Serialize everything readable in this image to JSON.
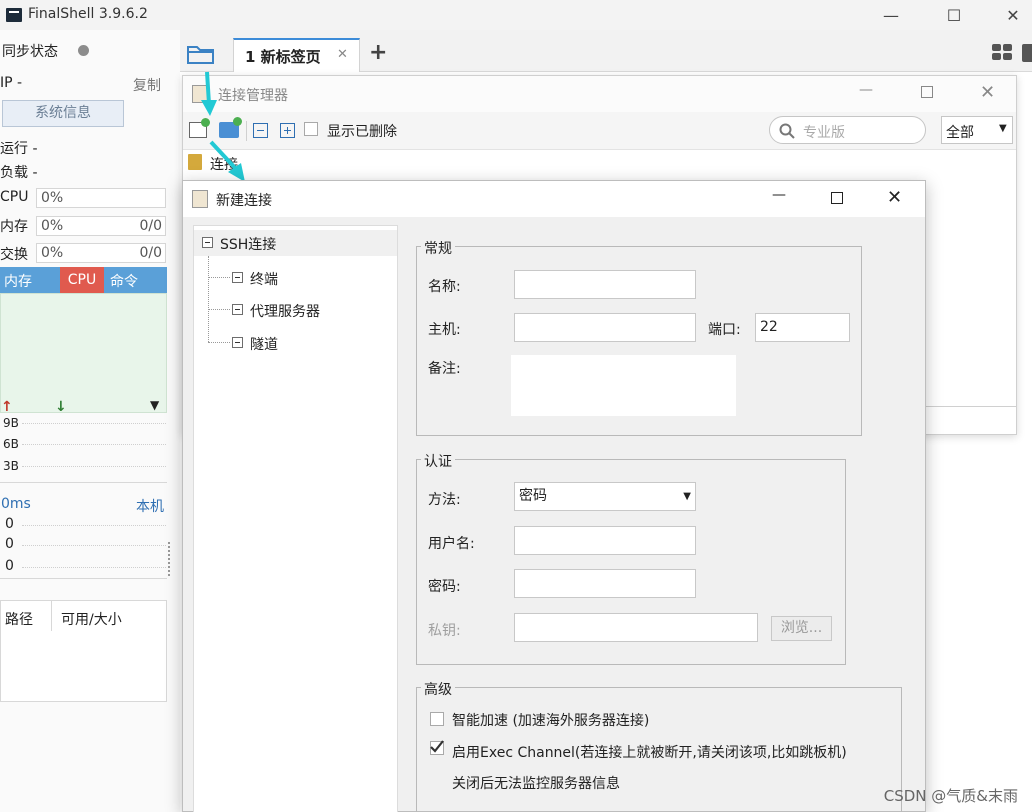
{
  "app": {
    "title": "FinalShell 3.9.6.2"
  },
  "window_controls": {
    "minimize": "—",
    "maximize": "☐",
    "close": "✕"
  },
  "left_panel": {
    "sync_label": "同步状态",
    "ip_label": "IP  -",
    "copy_label": "复制",
    "sysinfo_button": "系统信息",
    "run_label": "运行 -",
    "load_label": "负载 -",
    "cpu_label": "CPU",
    "cpu_value": "0%",
    "mem_label": "内存",
    "mem_value": "0%",
    "mem_ratio": "0/0",
    "swap_label": "交换",
    "swap_value": "0%",
    "swap_ratio": "0/0",
    "tabs": [
      "内存",
      "CPU",
      "命令"
    ],
    "net_rows": [
      "9B",
      "6B",
      "3B"
    ],
    "ping_label": "0ms",
    "local_label": "本机",
    "ping_rows": [
      "0",
      "0",
      "0"
    ],
    "file_cols": [
      "路径",
      "可用/大小"
    ]
  },
  "tab_strip": {
    "tab_label": "1 新标签页",
    "tab_close": "✕",
    "add_tab": "+"
  },
  "conn_manager": {
    "title": "连接管理器",
    "show_deleted": "显示已删除",
    "search_placeholder": "专业版",
    "filter_value": "全部",
    "tree_root": "连接"
  },
  "new_conn": {
    "title": "新建连接",
    "tree": {
      "root": "SSH连接",
      "items": [
        "终端",
        "代理服务器",
        "隧道"
      ]
    },
    "general": {
      "legend": "常规",
      "name_label": "名称:",
      "host_label": "主机:",
      "port_label": "端口:",
      "port_value": "22",
      "note_label": "备注:"
    },
    "auth": {
      "legend": "认证",
      "method_label": "方法:",
      "method_value": "密码",
      "user_label": "用户名:",
      "password_label": "密码:",
      "key_label": "私钥:",
      "browse_button": "浏览..."
    },
    "advanced": {
      "legend": "高级",
      "smart_accel": "智能加速 (加速海外服务器连接)",
      "smart_accel_checked": false,
      "exec_channel": "启用Exec Channel(若连接上就被断开,请关闭该项,比如跳板机)",
      "exec_channel_checked": true,
      "exec_note": "关闭后无法监控服务器信息"
    }
  },
  "watermark": "CSDN @气质&末雨",
  "colors": {
    "accent_blue": "#5aa0d8",
    "cpu_tab_red": "#e05a4e",
    "arrow_cyan": "#22c9d4",
    "arrow_up_red": "#c0392b",
    "arrow_down_green": "#2e7d32"
  }
}
